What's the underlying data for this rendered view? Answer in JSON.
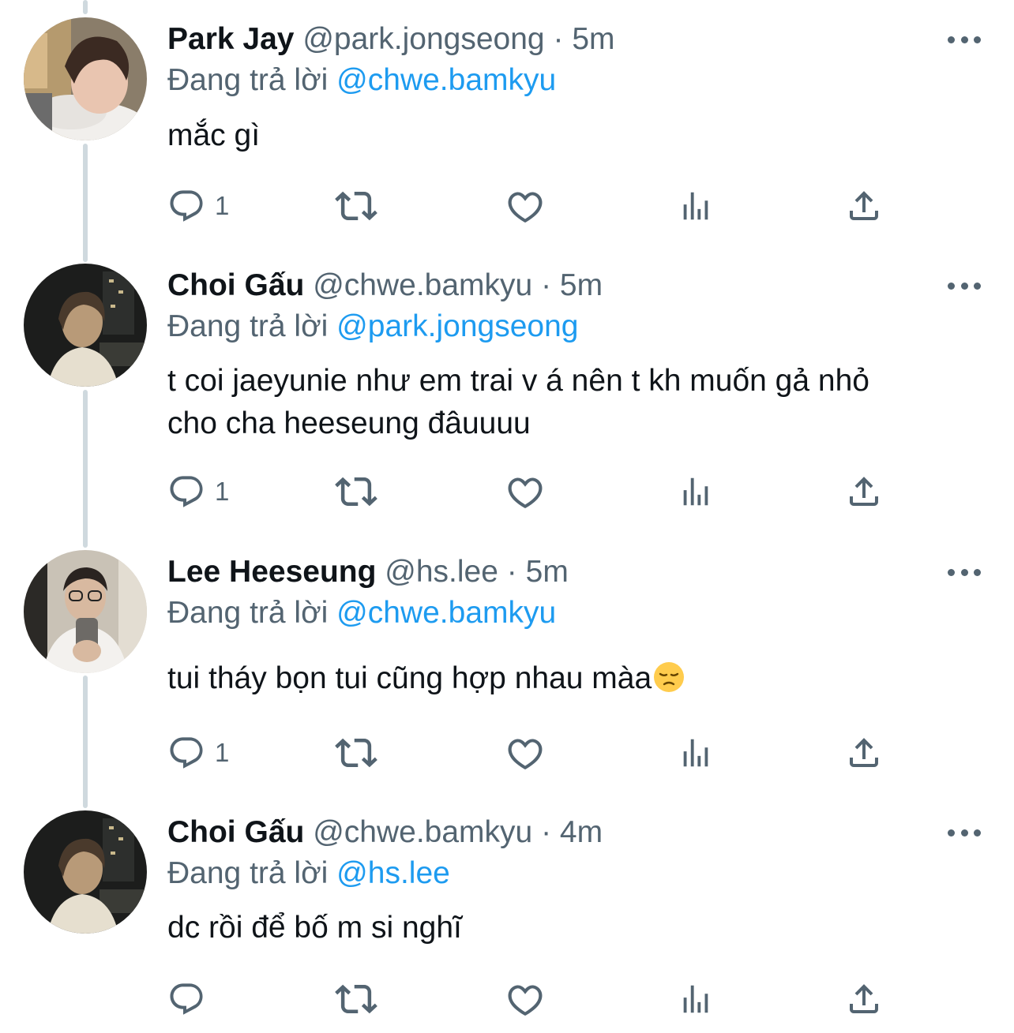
{
  "reply_label": "Đang trả lời",
  "separator": "·",
  "colors": {
    "link": "#1d9bf0",
    "muted": "#536471",
    "text": "#0f1419",
    "thread_line": "#cfd9de"
  },
  "icons": {
    "reply": "reply-icon",
    "retweet": "retweet-icon",
    "like": "heart-icon",
    "views": "views-bar-chart-icon",
    "share": "share-icon",
    "more": "more-options-icon"
  },
  "tweets": [
    {
      "name": "Park Jay",
      "handle": "@park.jongseong",
      "time": "5m",
      "reply_to": "@chwe.bamkyu",
      "text": "mắc gì",
      "reply_count": "1"
    },
    {
      "name": "Choi Gấu",
      "handle": "@chwe.bamkyu",
      "time": "5m",
      "reply_to": "@park.jongseong",
      "text_line1": "t coi jaeyunie như em trai v á nên t kh muốn gả nhỏ",
      "text_line2": "cho cha heeseung đâuuuu",
      "reply_count": "1"
    },
    {
      "name": "Lee Heeseung",
      "handle": "@hs.lee",
      "time": "5m",
      "reply_to": "@chwe.bamkyu",
      "text": "tui tháy bọn tui cũng hợp nhau màa",
      "emoji": "pensive-face-emoji",
      "reply_count": "1"
    },
    {
      "name": "Choi Gấu",
      "handle": "@chwe.bamkyu",
      "time": "4m",
      "reply_to": "@hs.lee",
      "text": "dc rồi để bố m si nghĩ",
      "reply_count": ""
    }
  ]
}
